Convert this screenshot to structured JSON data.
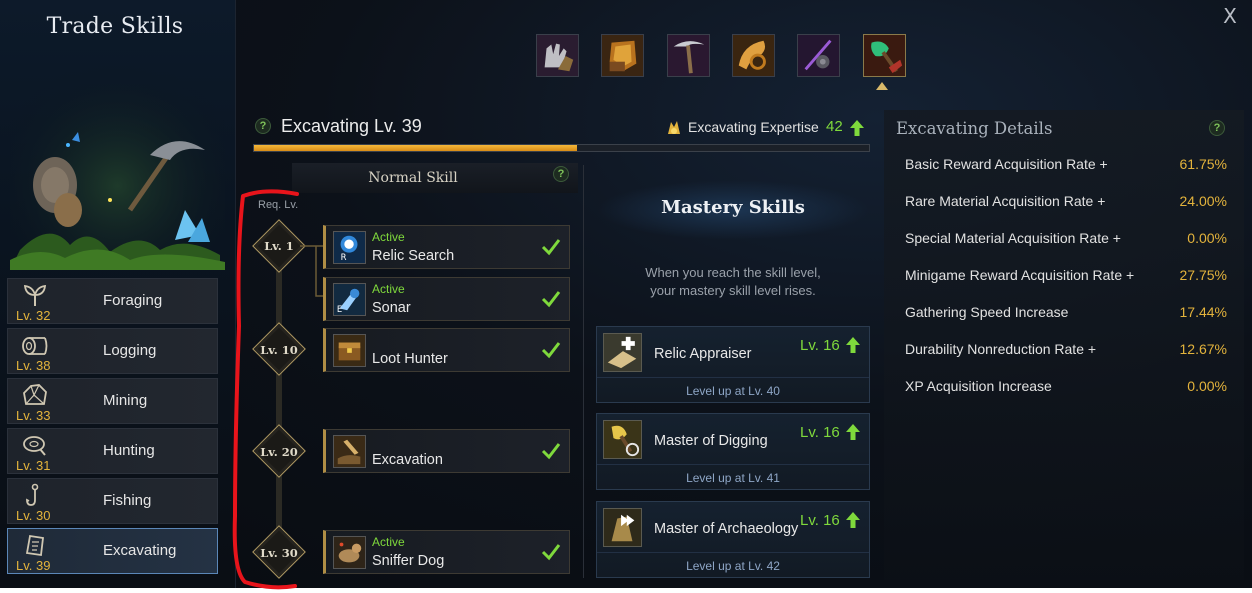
{
  "window": {
    "title": "Trade Skills",
    "close_label": "X"
  },
  "trade_skills": [
    {
      "name": "Foraging",
      "level": "Lv. 32",
      "icon": "sprout-icon"
    },
    {
      "name": "Logging",
      "level": "Lv. 38",
      "icon": "log-icon"
    },
    {
      "name": "Mining",
      "level": "Lv. 33",
      "icon": "ore-icon"
    },
    {
      "name": "Hunting",
      "level": "Lv. 31",
      "icon": "meat-icon"
    },
    {
      "name": "Fishing",
      "level": "Lv. 30",
      "icon": "fishing-hook-icon"
    },
    {
      "name": "Excavating",
      "level": "Lv. 39",
      "icon": "relic-icon",
      "selected": true
    }
  ],
  "skill_tabs": [
    {
      "icon": "gloves-icon"
    },
    {
      "icon": "axe-icon"
    },
    {
      "icon": "pickaxe-icon"
    },
    {
      "icon": "horn-icon"
    },
    {
      "icon": "fishing-rod-icon"
    },
    {
      "icon": "shovel-icon",
      "selected": true
    }
  ],
  "header": {
    "title": "Excavating Lv. 39",
    "help": "?",
    "expertise_label": "Excavating Expertise",
    "expertise_value": "42",
    "xp_progress": 0.525
  },
  "normal_skill": {
    "title": "Normal Skill",
    "help": "?",
    "req_label": "Req. Lv.",
    "levels": [
      "Lv. 1",
      "Lv. 10",
      "Lv. 20",
      "Lv. 30"
    ],
    "skills": [
      {
        "name": "Relic Search",
        "tag": "Active",
        "learned": true,
        "icon": "relic-search-icon"
      },
      {
        "name": "Sonar",
        "tag": "Active",
        "learned": true,
        "icon": "sonar-icon"
      },
      {
        "name": "Loot Hunter",
        "tag": "",
        "learned": true,
        "icon": "loot-hunter-icon"
      },
      {
        "name": "Excavation",
        "tag": "",
        "learned": true,
        "icon": "excavation-icon"
      },
      {
        "name": "Sniffer Dog",
        "tag": "Active",
        "learned": true,
        "icon": "sniffer-dog-icon"
      }
    ]
  },
  "mastery": {
    "title": "Mastery Skills",
    "description_line1": "When you reach the skill level,",
    "description_line2": "your mastery skill level rises.",
    "skills": [
      {
        "name": "Relic Appraiser",
        "level": "Lv. 16",
        "requirement": "Level up at Lv. 40",
        "icon": "relic-appraiser-icon"
      },
      {
        "name": "Master of Digging",
        "level": "Lv. 16",
        "requirement": "Level up at Lv. 41",
        "icon": "master-of-digging-icon"
      },
      {
        "name": "Master of Archaeology",
        "level": "Lv. 16",
        "requirement": "Level up at Lv. 42",
        "icon": "master-of-archaeology-icon"
      }
    ]
  },
  "details": {
    "title": "Excavating Details",
    "help": "?",
    "rows": [
      {
        "label": "Basic Reward Acquisition Rate +",
        "value": "61.75%"
      },
      {
        "label": "Rare Material Acquisition Rate +",
        "value": "24.00%"
      },
      {
        "label": "Special Material Acquisition Rate +",
        "value": "0.00%"
      },
      {
        "label": "Minigame Reward Acquisition Rate +",
        "value": "27.75%"
      },
      {
        "label": "Gathering Speed Increase",
        "value": "17.44%"
      },
      {
        "label": "Durability Nonreduction Rate +",
        "value": "12.67%"
      },
      {
        "label": "XP Acquisition Increase",
        "value": "0.00%"
      }
    ]
  },
  "colors": {
    "gold": "#e3b33c",
    "green": "#7fd93c",
    "annotation_red": "#e8141b",
    "selected_border": "#5b87b8"
  }
}
